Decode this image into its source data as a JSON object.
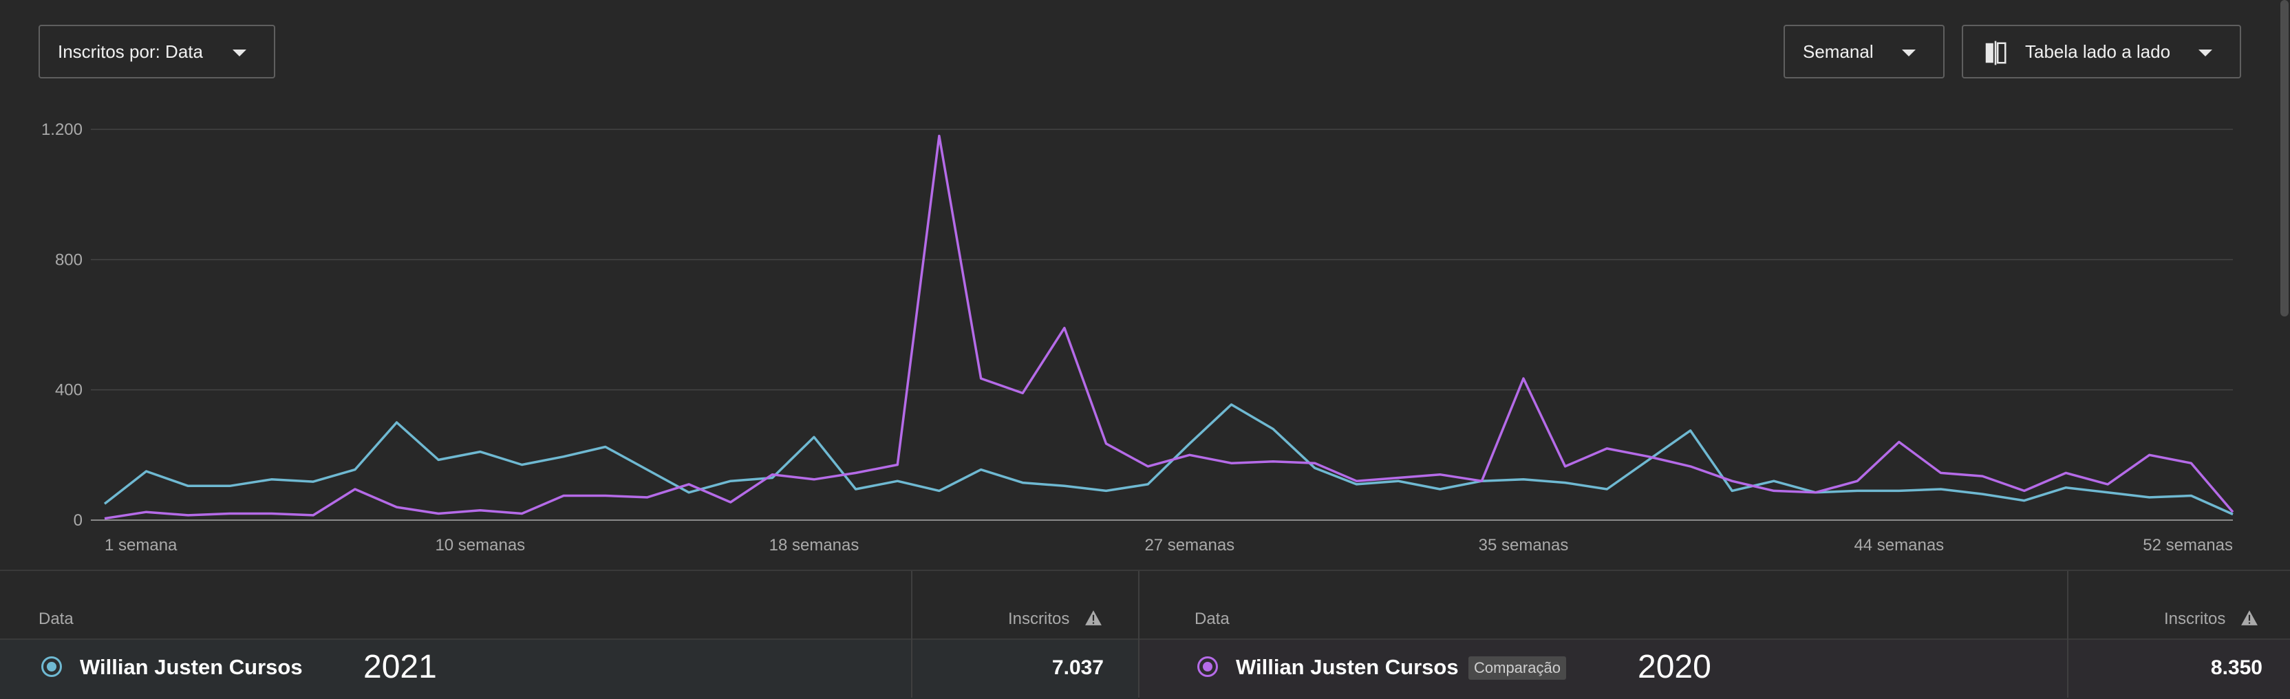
{
  "controls": {
    "metric_dropdown": "Inscritos por: Data",
    "period_dropdown": "Semanal",
    "view_dropdown": "Tabela lado a lado",
    "view_icon": "compare-icon"
  },
  "chart_data": {
    "type": "line",
    "x_tick_labels": [
      "1 semana",
      "10 semanas",
      "18 semanas",
      "27 semanas",
      "35 semanas",
      "44 semanas",
      "52 semanas"
    ],
    "x_tick_weeks": [
      1,
      10,
      18,
      27,
      35,
      44,
      52
    ],
    "x": [
      1,
      2,
      3,
      4,
      5,
      6,
      7,
      8,
      9,
      10,
      11,
      12,
      13,
      14,
      15,
      16,
      17,
      18,
      19,
      20,
      21,
      22,
      23,
      24,
      25,
      26,
      27,
      28,
      29,
      30,
      31,
      32,
      33,
      34,
      35,
      36,
      37,
      38,
      39,
      40,
      41,
      42,
      43,
      44,
      45,
      46,
      47,
      48,
      49,
      50,
      51,
      52
    ],
    "ylim": [
      0,
      1200
    ],
    "y_ticks": [
      0,
      400,
      800,
      1200
    ],
    "y_tick_labels": [
      "0",
      "400",
      "800",
      "1.200"
    ],
    "grid": true,
    "series": [
      {
        "name": "Willian Justen Cursos 2021",
        "color": "#6fb9d2",
        "values": [
          50,
          150,
          105,
          105,
          125,
          118,
          155,
          300,
          185,
          210,
          170,
          195,
          225,
          155,
          85,
          120,
          130,
          255,
          95,
          120,
          90,
          155,
          115,
          105,
          90,
          110,
          235,
          355,
          280,
          160,
          110,
          120,
          95,
          120,
          125,
          115,
          95,
          185,
          275,
          90,
          120,
          85,
          90,
          90,
          95,
          80,
          60,
          100,
          85,
          70,
          75,
          18
        ]
      },
      {
        "name": "Willian Justen Cursos 2020",
        "color": "#b56be8",
        "values": [
          5,
          25,
          15,
          20,
          20,
          15,
          95,
          40,
          20,
          30,
          20,
          75,
          75,
          70,
          110,
          55,
          140,
          125,
          145,
          170,
          1180,
          435,
          390,
          590,
          235,
          165,
          200,
          175,
          180,
          175,
          120,
          130,
          140,
          120,
          435,
          165,
          220,
          195,
          165,
          120,
          90,
          85,
          120,
          240,
          145,
          135,
          90,
          145,
          110,
          200,
          175,
          25
        ]
      }
    ]
  },
  "table_left": {
    "col_date": "Data",
    "col_metric": "Inscritos",
    "warn_icon": "warning-icon",
    "channel": "Willian Justen Cursos",
    "year": "2021",
    "value": "7.037"
  },
  "table_right": {
    "col_date": "Data",
    "col_metric": "Inscritos",
    "warn_icon": "warning-icon",
    "channel": "Willian Justen Cursos",
    "badge": "Comparação",
    "year": "2020",
    "value": "8.350"
  }
}
